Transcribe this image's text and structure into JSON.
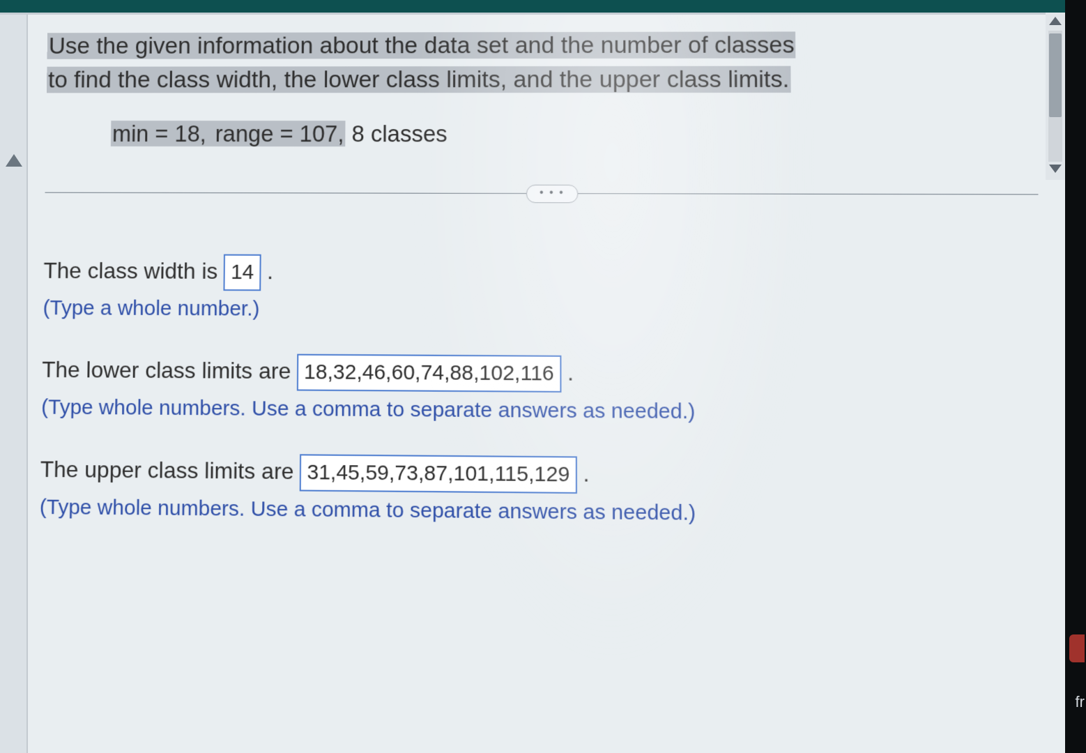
{
  "question": {
    "prompt_line1": "Use the given information about the data set and the number of classes",
    "prompt_line2": "to find the class width, the lower class limits, and the upper class limits.",
    "given_prefix": "min = 18,",
    "given_mid": " range = 107,",
    "given_suffix": " 8 classes"
  },
  "divider": {
    "dots": "• • •"
  },
  "answers": {
    "class_width": {
      "label_before": "The class width is ",
      "value": "14",
      "label_after": " .",
      "hint": "(Type a whole number.)"
    },
    "lower_limits": {
      "label_before": "The lower class limits are ",
      "value": "18,32,46,60,74,88,102,116",
      "label_after": " .",
      "hint": "(Type whole numbers. Use a comma to separate answers as needed.)"
    },
    "upper_limits": {
      "label_before": "The upper class limits are ",
      "value": "31,45,59,73,87,101,115,129",
      "label_after": " .",
      "hint": "(Type whole numbers. Use a comma to separate answers as needed.)"
    }
  },
  "rightedge": {
    "fr": "fr"
  }
}
